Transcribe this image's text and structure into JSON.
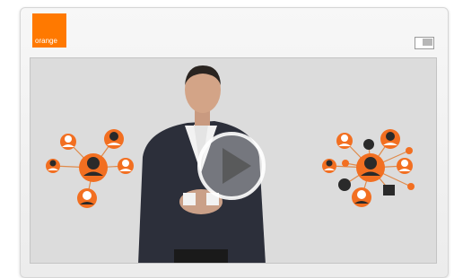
{
  "brand": {
    "name": "orange",
    "color": "#ff7900",
    "icon": "orange-logo"
  },
  "toolbar": {
    "popout_icon": "popout-window-icon"
  },
  "player": {
    "play_icon": "play-icon",
    "background_color": "#dcdcdc"
  }
}
